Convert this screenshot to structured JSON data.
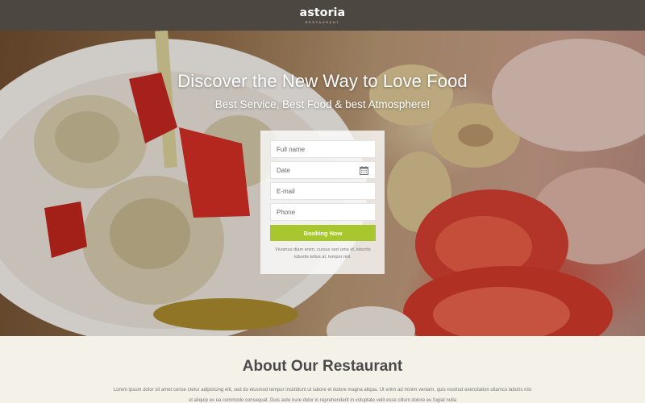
{
  "header": {
    "logo_name": "astoria",
    "logo_sub": "RESTAURANT"
  },
  "hero": {
    "title": "Discover the New Way to Love Food",
    "subtitle": "Best Service, Best Food & best Atmosphere!"
  },
  "booking": {
    "fields": {
      "full_name": "Full name",
      "date": "Date",
      "email": "E-mail",
      "phone": "Phone"
    },
    "button_label": "Booking Now",
    "note": "Vivamus diam enim, cursus sed urna id, lobortis lobortis tellus at, tempor nisl."
  },
  "about": {
    "title": "About Our Restaurant",
    "text": "Lorem ipsum dolor sit amet conse ctetur adipisicing elit, sed do eiusmod tempor incididunt ut labore et dolore magna aliqua. Ut enim ad minim veniam, quis nostrud exercitation ullamco laboris nisi ut aliquip ex ea commodo consequat. Duis aute irure dolor in reprehenderit in voluptate velit esse cillum dolore eu fugiat nulla"
  },
  "colors": {
    "header_bg": "#4c4741",
    "accent_green": "#a8c72e",
    "page_bg": "#f3f1e8"
  },
  "icons": {
    "date_field": "calendar-icon"
  }
}
